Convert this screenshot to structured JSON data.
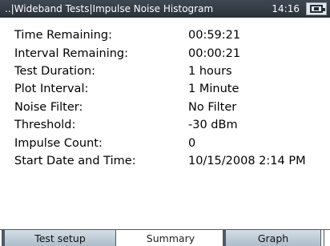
{
  "header": {
    "breadcrumb": "..|Wideband Tests|Impulse Noise Histogram",
    "time": "14:16",
    "status_icon": "battery-plug-icon"
  },
  "summary": {
    "rows": [
      {
        "label": "Time Remaining:",
        "value": "00:59:21"
      },
      {
        "label": "Interval Remaining:",
        "value": "00:00:21"
      },
      {
        "label": "Test Duration:",
        "value": "1 hours"
      },
      {
        "label": "Plot Interval:",
        "value": "1 Minute"
      },
      {
        "label": "Noise Filter:",
        "value": "No Filter"
      },
      {
        "label": "Threshold:",
        "value": "-30 dBm"
      },
      {
        "label": "Impulse Count:",
        "value": "0"
      },
      {
        "label": "Start Date and Time:",
        "value": "10/15/2008 2:14 PM"
      }
    ]
  },
  "tabs": [
    {
      "label": "Test setup",
      "active": false
    },
    {
      "label": "Summary",
      "active": true
    },
    {
      "label": "Graph",
      "active": false
    }
  ]
}
